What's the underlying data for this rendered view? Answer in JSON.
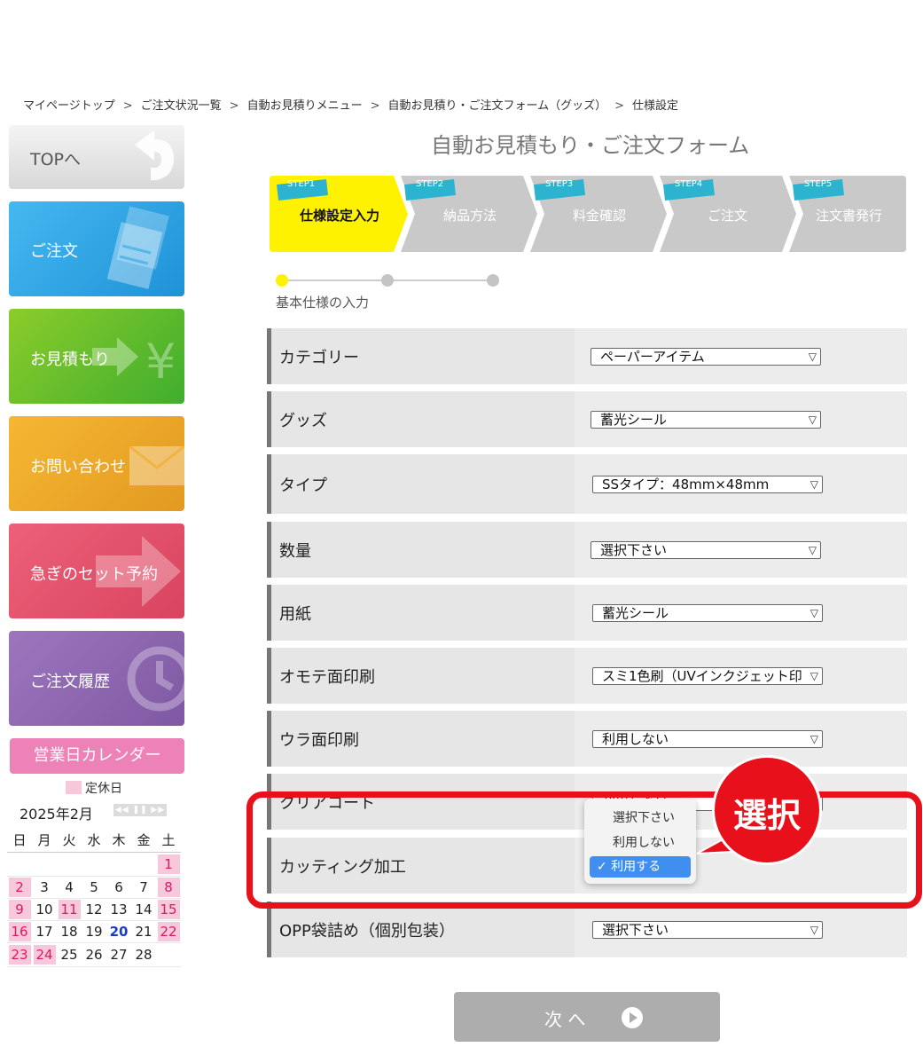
{
  "breadcrumb": {
    "items": [
      "マイページトップ",
      "ご注文状況一覧",
      "自動お見積りメニュー",
      "自動お見積り・ご注文フォーム（グッズ）",
      "仕様設定"
    ],
    "separator": ">"
  },
  "sidebar": {
    "top": "TOPへ",
    "order": "ご注文",
    "quote": "お見積もり",
    "inquiry": "お問い合わせ",
    "rush": "急ぎのセット予約",
    "history": "ご注文履歴",
    "colors": {
      "order": "#2ea6e8",
      "quote": "#64b81f",
      "inquiry": "#f0a827",
      "rush": "#e4526a",
      "history": "#9169b2"
    }
  },
  "calendar": {
    "title": "営業日カレンダー",
    "legend": "定休日",
    "month": "2025年2月",
    "nav": "◀◀ ❚❚ ▶▶",
    "weekdays": [
      "日",
      "月",
      "火",
      "水",
      "木",
      "金",
      "土"
    ],
    "weeks": [
      [
        "",
        "",
        "",
        "",
        "",
        "",
        "1"
      ],
      [
        "2",
        "3",
        "4",
        "5",
        "6",
        "7",
        "8"
      ],
      [
        "9",
        "10",
        "11",
        "12",
        "13",
        "14",
        "15"
      ],
      [
        "16",
        "17",
        "18",
        "19",
        "20",
        "21",
        "22"
      ],
      [
        "23",
        "24",
        "25",
        "26",
        "27",
        "28",
        ""
      ]
    ],
    "holidays": [
      "1",
      "2",
      "8",
      "9",
      "11",
      "15",
      "16",
      "22",
      "23",
      "24"
    ],
    "today": "20"
  },
  "form": {
    "title": "自動お見積もり・ご注文フォーム",
    "steps": [
      {
        "badge": "STEP1",
        "label": "仕様設定入力"
      },
      {
        "badge": "STEP2",
        "label": "納品方法"
      },
      {
        "badge": "STEP3",
        "label": "料金確認"
      },
      {
        "badge": "STEP4",
        "label": "ご注文"
      },
      {
        "badge": "STEP5",
        "label": "注文書発行"
      }
    ],
    "substep_label": "基本仕様の入力",
    "fields": [
      {
        "label": "カテゴリー",
        "value": "ペーパーアイテム"
      },
      {
        "label": "グッズ",
        "value": "蓄光シール"
      },
      {
        "label": "タイプ",
        "value": "SSタイプ：48mm×48mm"
      },
      {
        "label": "数量",
        "value": "選択下さい"
      },
      {
        "label": "用紙",
        "value": "蓄光シール"
      },
      {
        "label": "オモテ面印刷",
        "value": "スミ1色刷（UVインクジェット印"
      },
      {
        "label": "ウラ面印刷",
        "value": "利用しない"
      },
      {
        "label": "クリアコート",
        "value": "利用しない"
      },
      {
        "label": "カッティング加工",
        "value": ""
      },
      {
        "label": "OPP袋詰め（個別包装）",
        "value": "選択下さい"
      }
    ],
    "dropdown_options": [
      "選択下さい",
      "利用しない",
      "✓ 利用する"
    ],
    "next_button": "次 へ"
  },
  "annotation": {
    "callout": "選択",
    "color": "#e8101a"
  }
}
